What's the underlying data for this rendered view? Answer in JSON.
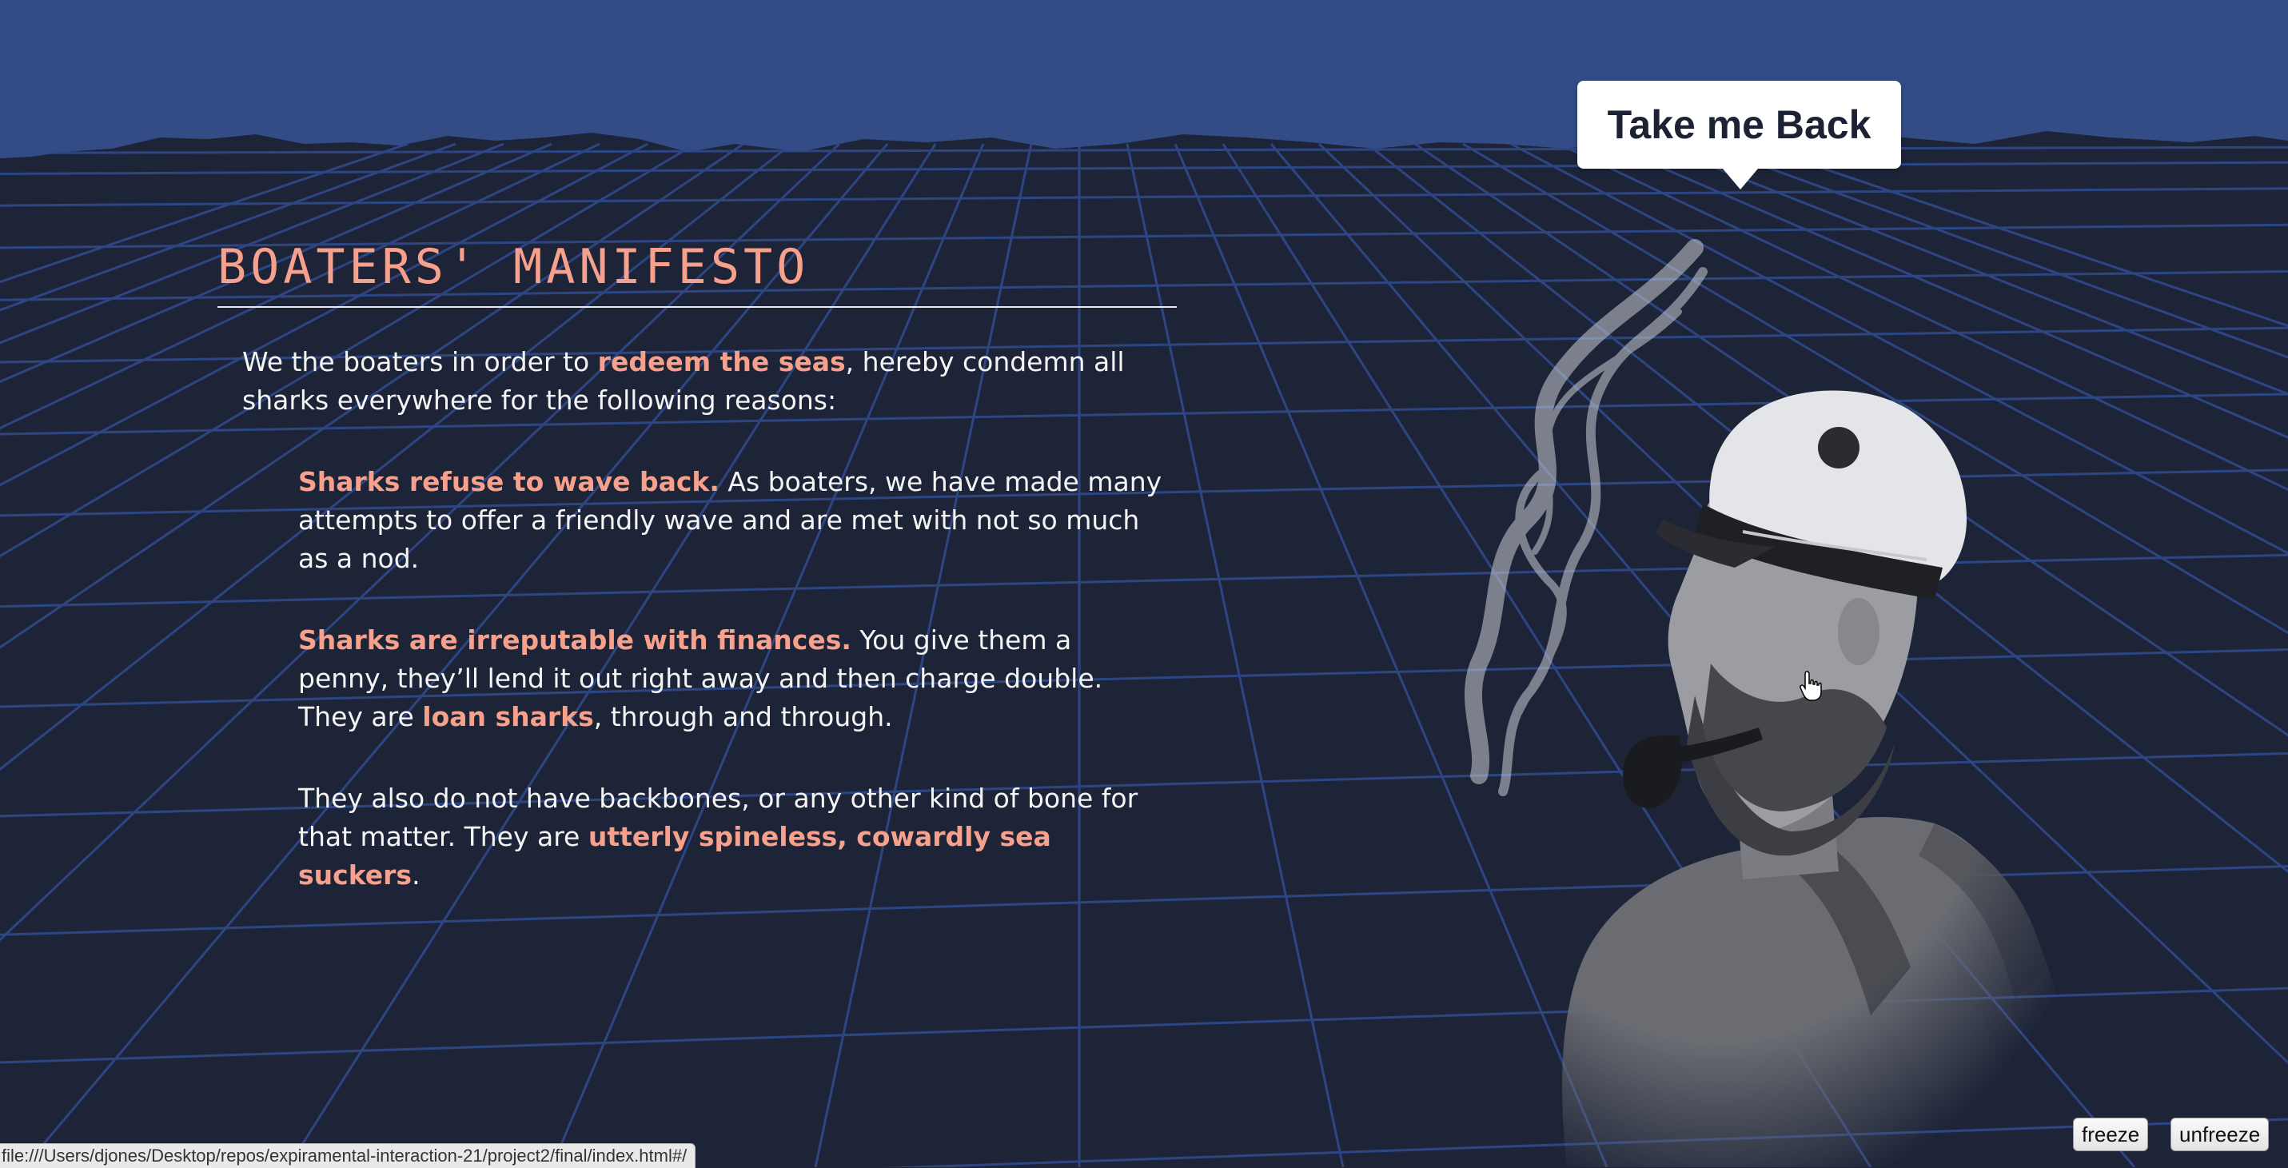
{
  "manifesto": {
    "title": "BOATERS' MANIFESTO",
    "intro": {
      "pre": "We the boaters in order to ",
      "highlight": "redeem the seas",
      "post": ", hereby condemn all sharks everywhere for the following reasons:"
    },
    "reasons": [
      {
        "lead": "Sharks refuse to wave back.",
        "text": " As boaters, we have made many attempts to offer a friendly wave and are met with not so much as a nod."
      },
      {
        "lead": "Sharks are irreputable with finances.",
        "text_a": " You give them a penny, they’ll lend it out right away and then charge double. They are ",
        "highlight": "loan sharks",
        "text_b": ", through and through."
      },
      {
        "text_a": "They also do not have backbones, or any other kind of bone for that matter. They are ",
        "highlight": "utterly spineless, cowardly sea suckers",
        "text_b": "."
      }
    ]
  },
  "back_button": {
    "label": "Take me Back"
  },
  "controls": {
    "freeze_label": "freeze",
    "unfreeze_label": "unfreeze"
  },
  "status_bar": {
    "url": "file:///Users/djones/Desktop/repos/expiramental-interaction-21/project2/final/index.html#/"
  },
  "colors": {
    "sky": "#344c86",
    "sea": "#1d2438",
    "grid": "#2f4a8c",
    "accent": "#f7a08c",
    "text": "#f4f4f4"
  },
  "icons": {
    "cursor": "hand-pointer-icon",
    "figure": "sailor-with-pipe"
  }
}
